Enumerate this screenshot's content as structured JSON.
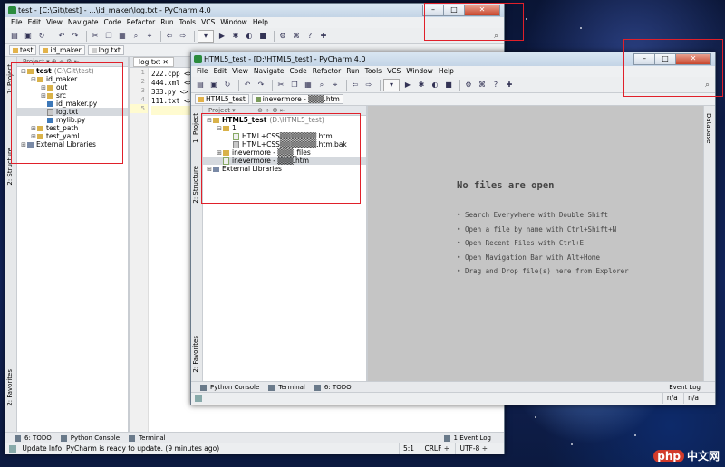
{
  "back_window": {
    "title": "test - [C:\\Git\\test] - ...\\id_maker\\log.txt - PyCharm 4.0",
    "menu": [
      "File",
      "Edit",
      "View",
      "Navigate",
      "Code",
      "Refactor",
      "Run",
      "Tools",
      "VCS",
      "Window",
      "Help"
    ],
    "breadcrumbs": [
      "test",
      "id_maker",
      "log.txt"
    ],
    "panel_label": "Project",
    "editor_tab": "log.txt",
    "left_strip": [
      "1: Project",
      "2: Structure",
      "2: Favorites"
    ],
    "tree": [
      {
        "label": "test",
        "path": "(C:\\Git\\test)",
        "level": 0,
        "type": "folder",
        "expanded": true
      },
      {
        "label": "id_maker",
        "level": 1,
        "type": "folder",
        "expanded": true
      },
      {
        "label": "out",
        "level": 2,
        "type": "folder",
        "expanded": false
      },
      {
        "label": "src",
        "level": 2,
        "type": "folder",
        "expanded": false
      },
      {
        "label": "id_maker.py",
        "level": 2,
        "type": "py"
      },
      {
        "label": "log.txt",
        "level": 2,
        "type": "txt",
        "selected": true
      },
      {
        "label": "mylib.py",
        "level": 2,
        "type": "py"
      },
      {
        "label": "test_path",
        "level": 1,
        "type": "folder",
        "expanded": false
      },
      {
        "label": "test_yaml",
        "level": 1,
        "type": "folder",
        "expanded": false
      },
      {
        "label": "External Libraries",
        "level": 0,
        "type": "lib",
        "expanded": false
      }
    ],
    "code_lines": [
      "222.cpp <>",
      "444.xml <>",
      "333.py <>",
      "111.txt <>",
      ""
    ],
    "line_numbers": [
      "1",
      "2",
      "3",
      "4",
      "5"
    ],
    "tool_windows": [
      "6: TODO",
      "Python Console",
      "Terminal"
    ],
    "event_log": "1 Event Log",
    "status_text": "Update Info: PyCharm is ready to update. (9 minutes ago)",
    "status_cells": [
      "5:1",
      "CRLF ÷",
      "UTF-8 ÷"
    ]
  },
  "front_window": {
    "title": "HTML5_test - [D:\\HTML5_test] - PyCharm 4.0",
    "menu": [
      "File",
      "Edit",
      "View",
      "Navigate",
      "Code",
      "Refactor",
      "Run",
      "Tools",
      "VCS",
      "Window",
      "Help"
    ],
    "breadcrumbs": [
      "HTML5_test",
      "inevermore - ▒▒▒.htm"
    ],
    "panel_label": "Project",
    "left_strip": [
      "1: Project",
      "2: Structure",
      "2: Favorites"
    ],
    "right_strip": "Database",
    "tree": [
      {
        "label": "HTML5_test",
        "path": "(D:\\HTML5_test)",
        "level": 0,
        "type": "folder",
        "expanded": true
      },
      {
        "label": "1",
        "level": 1,
        "type": "folder",
        "expanded": true
      },
      {
        "label": "HTML+CSS▒▒▒▒▒▒▒.htm",
        "level": 2,
        "type": "htm"
      },
      {
        "label": "HTML+CSS▒▒▒▒▒▒▒.htm.bak",
        "level": 2,
        "type": "txt"
      },
      {
        "label": "inevermore - ▒▒▒_files",
        "level": 1,
        "type": "folder",
        "expanded": false
      },
      {
        "label": "inevermore - ▒▒▒.htm",
        "level": 1,
        "type": "htm",
        "selected": true
      },
      {
        "label": "External Libraries",
        "level": 0,
        "type": "lib",
        "expanded": false
      }
    ],
    "empty_title": "No files are open",
    "empty_hints": [
      "• Search Everywhere with Double Shift",
      "• Open a file by name with Ctrl+Shift+N",
      "• Open Recent Files with Ctrl+E",
      "• Open Navigation Bar with Alt+Home",
      "• Drag and Drop file(s) here from Explorer"
    ],
    "tool_windows": [
      "Python Console",
      "Terminal",
      "6: TODO"
    ],
    "event_log": "Event Log",
    "status_cells": [
      "n/a",
      "n/a"
    ]
  },
  "watermark": {
    "logo": "php",
    "text": "中文网"
  }
}
